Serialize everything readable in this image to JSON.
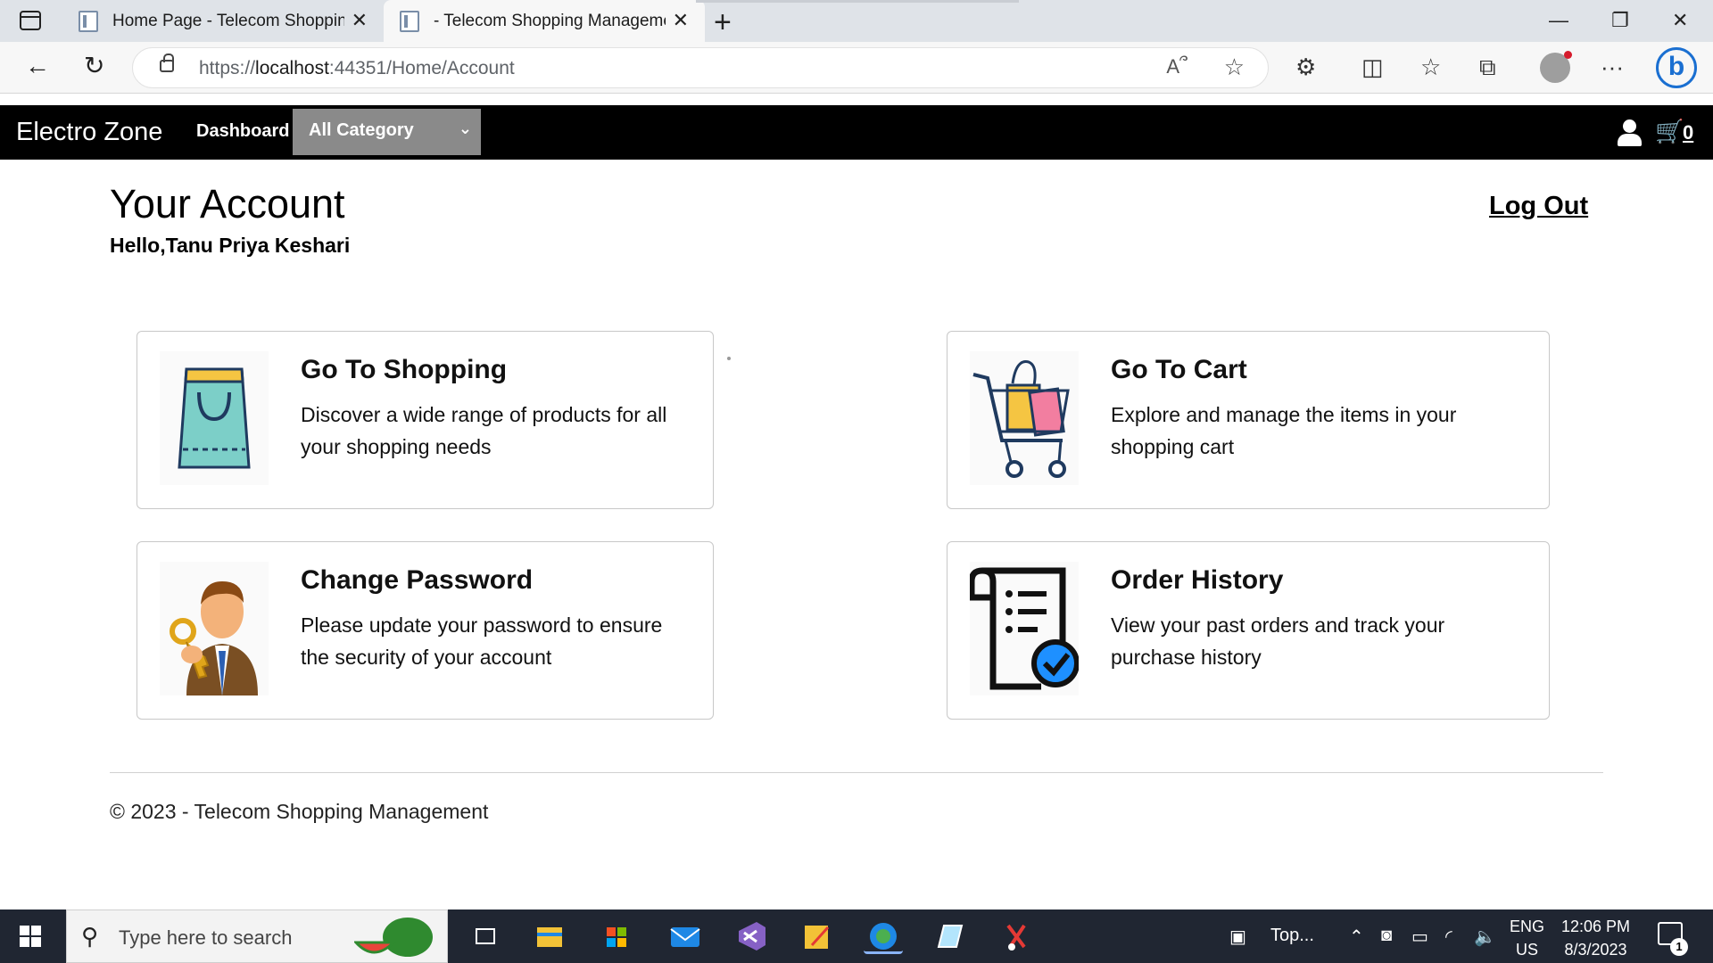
{
  "browser": {
    "tabs": [
      {
        "label": "Home Page - Telecom Shopping"
      },
      {
        "label": "- Telecom Shopping Managemer"
      }
    ],
    "url_prefix": "https://",
    "url_host": "localhost",
    "url_rest": ":44351/Home/Account"
  },
  "site": {
    "brand": "Electro Zone",
    "nav_dashboard": "Dashboard",
    "category_select": "All Category",
    "cart_count": "0"
  },
  "account": {
    "title": "Your Account",
    "greeting": "Hello,Tanu Priya Keshari",
    "logout": "Log Out"
  },
  "cards": [
    {
      "title": "Go To Shopping",
      "description": "Discover a wide range of products for all your shopping needs",
      "icon": "shopping-bag-icon"
    },
    {
      "title": "Go To Cart",
      "description": "Explore and manage the items in your shopping cart",
      "icon": "shopping-cart-icon"
    },
    {
      "title": "Change Password",
      "description": "Please update your password to ensure the security of your account",
      "icon": "man-with-key-icon"
    },
    {
      "title": "Order History",
      "description": "View your past orders and track your purchase history",
      "icon": "order-receipt-check-icon"
    }
  ],
  "footer": {
    "text": "© 2023 - Telecom Shopping Management"
  },
  "taskbar": {
    "search_placeholder": "Type here to search",
    "widget_label": "Top...",
    "lang_line1": "ENG",
    "lang_line2": "US",
    "time": "12:06 PM",
    "date": "8/3/2023",
    "notification_count": "1"
  },
  "colors": {
    "header_bg": "#000000",
    "category_bg": "#8a8a8a",
    "taskbar_bg": "#202632",
    "link_blue": "#1a73e8"
  }
}
